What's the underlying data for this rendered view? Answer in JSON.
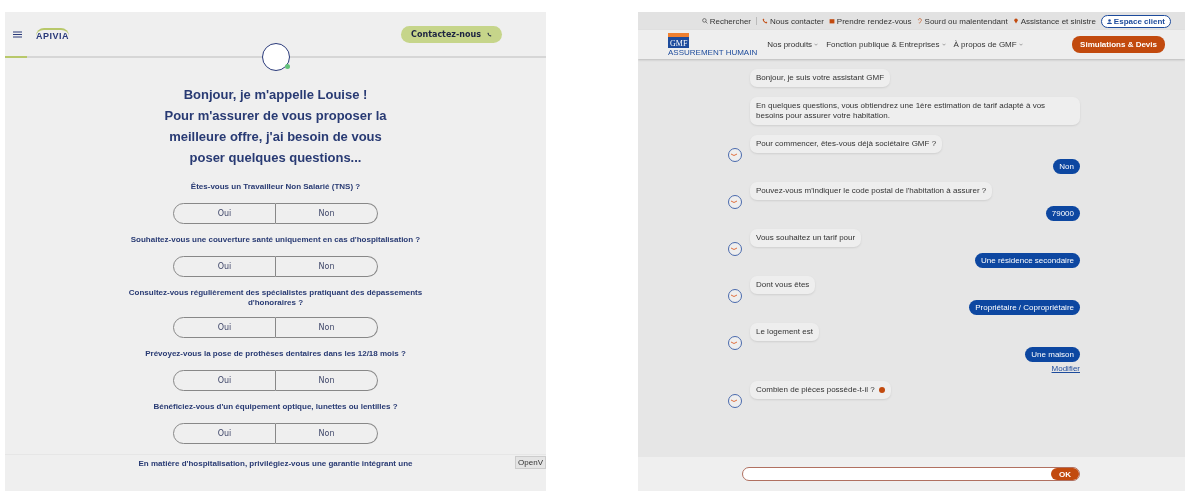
{
  "left_page": {
    "logo": "APIVIA",
    "contact_button": "Contactez-nous",
    "progress": {
      "level": 0.04
    },
    "greeting": [
      "Bonjour, je m'appelle Louise !",
      "Pour m'assurer de vous proposer la",
      "meilleure offre, j'ai besoin de vous",
      "poser quelques questions..."
    ],
    "questions": [
      {
        "text": "Êtes-vous un Travailleur Non Salarié (TNS) ?",
        "options": [
          {
            "label": "Oui",
            "selected": false
          },
          {
            "label": "Non",
            "selected": false
          }
        ]
      },
      {
        "text": "Souhaitez-vous une couverture santé uniquement en cas d'hospitalisation ?",
        "options": [
          {
            "label": "Oui",
            "selected": false
          },
          {
            "label": "Non",
            "selected": false
          }
        ]
      },
      {
        "text": "Consultez-vous régulièrement des spécialistes pratiquant des dépassements d'honoraires ?",
        "options": [
          {
            "label": "Oui",
            "selected": false
          },
          {
            "label": "Non",
            "selected": false
          }
        ]
      },
      {
        "text": "Prévoyez-vous la pose de prothèses dentaires dans les 12/18 mois ?",
        "options": [
          {
            "label": "Oui",
            "selected": false
          },
          {
            "label": "Non",
            "selected": false
          }
        ]
      },
      {
        "text": "Bénéficiez-vous d'un équipement optique, lunettes ou lentilles ?",
        "options": [
          {
            "label": "Oui",
            "selected": false
          },
          {
            "label": "Non",
            "selected": false
          }
        ]
      }
    ],
    "cut_question": "En matière d'hospitalisation, privilégiez-vous une garantie intégrant une",
    "corner_button": "OpenV"
  },
  "right_page": {
    "utility_links": [
      {
        "kind": "search",
        "label": "Rechercher"
      },
      {
        "kind": "phone",
        "label": "Nous contacter"
      },
      {
        "kind": "calendar",
        "label": "Prendre rendez-vous"
      },
      {
        "kind": "ear",
        "label": "Sourd ou malentendant"
      },
      {
        "kind": "pin",
        "label": "Assistance et sinistre"
      }
    ],
    "client_button": "Espace client",
    "logo": "GMF",
    "logo_tagline": "ASSUREMENT HUMAIN",
    "nav": [
      "Nos produits",
      "Fonction publique & Entreprises",
      "À propos de GMF"
    ],
    "cta": "Simulations & Devis",
    "messages": [
      {
        "kind": "intro",
        "text": "Bonjour, je suis votre assistant GMF"
      },
      {
        "kind": "intro",
        "text": "En quelques questions, vous obtiendrez une 1ère estimation de tarif adapté à vos besoins pour assurer votre habitation."
      },
      {
        "kind": "bot",
        "text": "Pour commencer, êtes-vous déjà sociétaire GMF ?"
      },
      {
        "kind": "user",
        "text": "Non"
      },
      {
        "kind": "bot",
        "text": "Pouvez-vous m'indiquer le code postal de l'habitation à assurer ?"
      },
      {
        "kind": "user",
        "text": "79000"
      },
      {
        "kind": "bot",
        "text": "Vous souhaitez un tarif pour"
      },
      {
        "kind": "user",
        "text": "Une résidence secondaire"
      },
      {
        "kind": "bot",
        "text": "Dont vous êtes"
      },
      {
        "kind": "user",
        "text": "Propriétaire / Copropriétaire"
      },
      {
        "kind": "bot",
        "text": "Le logement est"
      },
      {
        "kind": "user",
        "text": "Une maison",
        "link": "Modifier"
      },
      {
        "kind": "bot",
        "text": "Combien de pièces possède-t-il ?",
        "info": true
      }
    ],
    "ok_button": "OK"
  }
}
